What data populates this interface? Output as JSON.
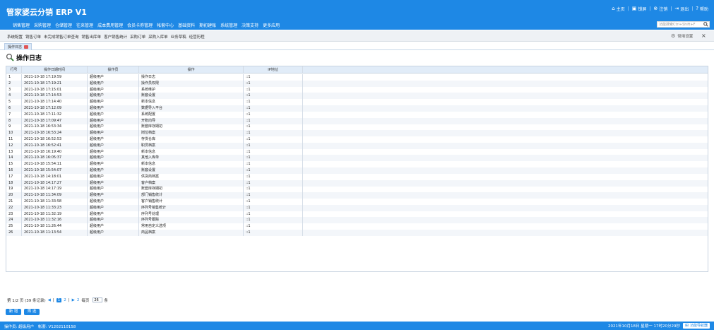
{
  "header": {
    "title": "管家婆云分销 ERP V1",
    "top_links": [
      {
        "label": "主页",
        "icon": "home-icon"
      },
      {
        "label": "锁屏",
        "icon": "lock-icon"
      },
      {
        "label": "注销",
        "icon": "logout-icon"
      },
      {
        "label": "退出",
        "icon": "exit-icon"
      },
      {
        "label": "帮助",
        "icon": "help-icon"
      }
    ],
    "nav": [
      "销售管理",
      "采购管理",
      "仓储管理",
      "往来管理",
      "成本费用管理",
      "会员卡券管理",
      "帐套中心",
      "基础资料",
      "期初建账",
      "系统管理",
      "决策支持",
      "更多应用"
    ],
    "search": {
      "placeholder": "功能搜索Ctrl+Shift+F"
    }
  },
  "quickbar": {
    "links": [
      "系统配置",
      "销售订单",
      "未完成销售订单查询",
      "销售出库单",
      "客户销售统计",
      "采购订单",
      "采购入库单",
      "业务草稿",
      "经营历程"
    ],
    "settings_label": "常用设置",
    "close_label": "×"
  },
  "tab": {
    "label": "操作日志"
  },
  "page": {
    "title": "操作日志"
  },
  "table": {
    "headers": [
      "行号",
      "操作日期时间",
      "操作员",
      "操作",
      "IP地址"
    ],
    "rows": [
      [
        "1",
        "2021-10-18 17:19:59",
        "超级用户",
        "操作日志",
        "::1"
      ],
      [
        "2",
        "2021-10-18 17:19:21",
        "超级用户",
        "操作员权限",
        "::1"
      ],
      [
        "3",
        "2021-10-18 17:15:01",
        "超级用户",
        "系统维护",
        "::1"
      ],
      [
        "4",
        "2021-10-18 17:14:53",
        "超级用户",
        "账套设置",
        "::1"
      ],
      [
        "5",
        "2021-10-18 17:14:40",
        "超级用户",
        "新本信息",
        "::1"
      ],
      [
        "6",
        "2021-10-18 17:12:09",
        "超级用户",
        "数据导入平台",
        "::1"
      ],
      [
        "7",
        "2021-10-18 17:11:32",
        "超级用户",
        "系统配置",
        "::1"
      ],
      [
        "8",
        "2021-10-18 17:09:47",
        "超级用户",
        "开账向导",
        "::1"
      ],
      [
        "9",
        "2021-10-18 16:53:34",
        "超级用户",
        "账套库存期初",
        "::1"
      ],
      [
        "10",
        "2021-10-18 16:53:24",
        "超级用户",
        "岗位档案",
        "::1"
      ],
      [
        "11",
        "2021-10-18 16:52:53",
        "超级用户",
        "存货仓库",
        "::1"
      ],
      [
        "12",
        "2021-10-18 16:52:41",
        "超级用户",
        "职员档案",
        "::1"
      ],
      [
        "13",
        "2021-10-18 16:19:40",
        "超级用户",
        "新本信息",
        "::1"
      ],
      [
        "14",
        "2021-10-18 16:05:37",
        "超级用户",
        "其他入库单",
        "::1"
      ],
      [
        "15",
        "2021-10-18 15:54:11",
        "超级用户",
        "新本信息",
        "::1"
      ],
      [
        "16",
        "2021-10-18 15:54:07",
        "超级用户",
        "账套设置",
        "::1"
      ],
      [
        "17",
        "2021-10-18 14:18:01",
        "超级用户",
        "供货商档案",
        "::1"
      ],
      [
        "18",
        "2021-10-18 14:17:27",
        "超级用户",
        "客户档案",
        "::1"
      ],
      [
        "19",
        "2021-10-18 14:17:19",
        "超级用户",
        "账套库存期初",
        "::1"
      ],
      [
        "20",
        "2021-10-18 11:34:09",
        "超级用户",
        "部门销售统计",
        "::1"
      ],
      [
        "21",
        "2021-10-18 11:33:58",
        "超级用户",
        "客户销售统计",
        "::1"
      ],
      [
        "22",
        "2021-10-18 11:33:23",
        "超级用户",
        "序列号销售统计",
        "::1"
      ],
      [
        "23",
        "2021-10-18 11:32:19",
        "超级用户",
        "序列号处理",
        "::1"
      ],
      [
        "24",
        "2021-10-18 11:32:16",
        "超级用户",
        "序列号跟踪",
        "::1"
      ],
      [
        "25",
        "2021-10-18 11:26:44",
        "超级用户",
        "常用自定义选项",
        "::1"
      ],
      [
        "26",
        "2021-10-18 11:13:54",
        "超级用户",
        "商品档案",
        "::1"
      ]
    ]
  },
  "pager": {
    "summary": "第 1/2 页 (39 条记录)",
    "prev": "◀",
    "pages": [
      "1",
      "2"
    ],
    "next": "▶",
    "last": "2",
    "per_page_label": "每页",
    "per_page_value": "26",
    "unit": "条"
  },
  "buttons": {
    "add": "新 增",
    "filter": "筛 选"
  },
  "footer": {
    "operator": "操作员: 超级用户",
    "account": "帐套: V1202110158",
    "datetime": "2021年10月18日 星期一 17时20分29秒",
    "navigator": "功能导航器"
  },
  "colors": {
    "primary": "#1E88E5",
    "header_bg": "#1E88E5",
    "table_head": "#E1ECF8",
    "row_alt": "#F3F6FA"
  }
}
